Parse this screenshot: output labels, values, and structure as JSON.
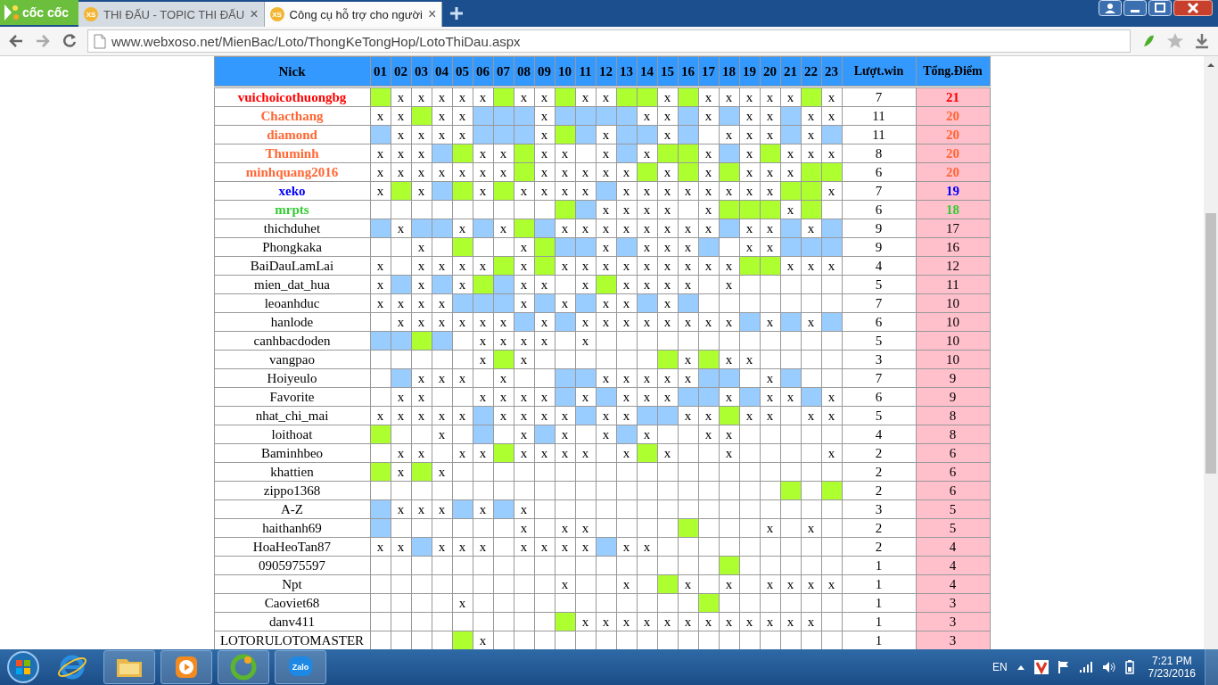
{
  "browser": {
    "logo_text": "cốc cốc",
    "tabs": [
      {
        "icon_text": "XS",
        "title": "THI ĐẤU - TOPIC THI ĐẤU",
        "close": "×",
        "selected": false
      },
      {
        "icon_text": "XS",
        "title": "Công cụ hỗ trợ cho người",
        "close": "×",
        "selected": true
      }
    ],
    "address": "www.webxoso.net/MienBac/Loto/ThongKeTongHop/LotoThiDau.aspx"
  },
  "table": {
    "columns": [
      "Nick",
      "01",
      "02",
      "03",
      "04",
      "05",
      "06",
      "07",
      "08",
      "09",
      "10",
      "11",
      "12",
      "13",
      "14",
      "15",
      "16",
      "17",
      "18",
      "19",
      "20",
      "21",
      "22",
      "23",
      "Lượt.win",
      "Tổng.Điểm"
    ],
    "rows": [
      {
        "color": "#ff0000",
        "cells": [
          "vuichoicothuongbg",
          {
            "kind": "green"
          },
          "x",
          "x",
          "x",
          "x",
          "x",
          {
            "kind": "green"
          },
          "x",
          "x",
          {
            "kind": "green"
          },
          "x",
          "x",
          {
            "kind": "green"
          },
          {
            "kind": "green"
          },
          "x",
          {
            "kind": "green"
          },
          "x",
          "x",
          "x",
          "x",
          "x",
          {
            "kind": "green"
          },
          "x",
          "7",
          "21"
        ]
      },
      {
        "color": "#ff6633",
        "cells": [
          "Chacthang",
          "x",
          "x",
          {
            "kind": "green"
          },
          "x",
          "x",
          {
            "kind": "blue"
          },
          {
            "kind": "blue"
          },
          {
            "kind": "blue"
          },
          "x",
          {
            "kind": "blue"
          },
          {
            "kind": "blue"
          },
          {
            "kind": "blue"
          },
          {
            "kind": "blue"
          },
          "x",
          "x",
          {
            "kind": "blue"
          },
          "x",
          {
            "kind": "blue"
          },
          "x",
          "x",
          {
            "kind": "blue"
          },
          "x",
          "x",
          "11",
          "20"
        ]
      },
      {
        "color": "#ff6633",
        "cells": [
          "diamond",
          {
            "kind": "blue"
          },
          "x",
          "x",
          "x",
          "x",
          {
            "kind": "blue"
          },
          {
            "kind": "blue"
          },
          {
            "kind": "blue"
          },
          "x",
          {
            "kind": "green"
          },
          {
            "kind": "blue"
          },
          "x",
          {
            "kind": "blue"
          },
          {
            "kind": "blue"
          },
          "x",
          {
            "kind": "blue"
          },
          "",
          "x",
          "x",
          "x",
          {
            "kind": "blue"
          },
          "x",
          {
            "kind": "blue"
          },
          "11",
          "20"
        ]
      },
      {
        "color": "#ff6633",
        "cells": [
          "Thuminh",
          "x",
          "x",
          "x",
          {
            "kind": "blue"
          },
          {
            "kind": "green"
          },
          "x",
          "x",
          {
            "kind": "green"
          },
          "x",
          "x",
          "",
          "x",
          {
            "kind": "blue"
          },
          "x",
          {
            "kind": "green"
          },
          {
            "kind": "green"
          },
          "x",
          {
            "kind": "blue"
          },
          "x",
          {
            "kind": "green"
          },
          "x",
          "x",
          "x",
          "8",
          "20"
        ]
      },
      {
        "color": "#ff6633",
        "cells": [
          "minhquang2016",
          "x",
          "x",
          "x",
          "x",
          "x",
          "x",
          "x",
          {
            "kind": "green"
          },
          "x",
          "x",
          "x",
          "x",
          "x",
          {
            "kind": "green"
          },
          "x",
          {
            "kind": "green"
          },
          "x",
          {
            "kind": "green"
          },
          "x",
          "x",
          "x",
          {
            "kind": "green"
          },
          {
            "kind": "green"
          },
          "6",
          "20"
        ]
      },
      {
        "color": "#0000ff",
        "cells": [
          "xeko",
          "x",
          {
            "kind": "green"
          },
          "x",
          {
            "kind": "blue"
          },
          {
            "kind": "green"
          },
          "x",
          {
            "kind": "green"
          },
          "x",
          "x",
          "x",
          "x",
          {
            "kind": "blue"
          },
          "x",
          "x",
          "x",
          "x",
          "x",
          "x",
          "x",
          "x",
          {
            "kind": "green"
          },
          {
            "kind": "green"
          },
          "x",
          "7",
          "19"
        ]
      },
      {
        "color": "#33cc33",
        "cells": [
          "mrpts",
          "",
          "",
          "",
          "",
          "",
          "",
          "",
          "",
          "",
          {
            "kind": "green"
          },
          {
            "kind": "blue"
          },
          "x",
          "x",
          "x",
          "x",
          "",
          "x",
          {
            "kind": "green"
          },
          {
            "kind": "green"
          },
          {
            "kind": "green"
          },
          "x",
          {
            "kind": "green"
          },
          "",
          "6",
          "18"
        ]
      },
      {
        "cells": [
          "thichduhet",
          {
            "kind": "blue"
          },
          "x",
          {
            "kind": "blue"
          },
          {
            "kind": "blue"
          },
          "x",
          {
            "kind": "blue"
          },
          "x",
          {
            "kind": "green"
          },
          {
            "kind": "blue"
          },
          "x",
          "x",
          "x",
          "x",
          "x",
          "x",
          "x",
          "x",
          {
            "kind": "blue"
          },
          "x",
          "x",
          {
            "kind": "blue"
          },
          "x",
          {
            "kind": "blue"
          },
          "9",
          "17"
        ]
      },
      {
        "cells": [
          "Phongkaka",
          "",
          "",
          "x",
          "",
          {
            "kind": "green"
          },
          "",
          "",
          "x",
          {
            "kind": "green"
          },
          {
            "kind": "blue"
          },
          {
            "kind": "blue"
          },
          "x",
          {
            "kind": "blue"
          },
          "x",
          "x",
          "x",
          {
            "kind": "blue"
          },
          "",
          "x",
          "x",
          {
            "kind": "blue"
          },
          {
            "kind": "blue"
          },
          {
            "kind": "blue"
          },
          "9",
          "16"
        ]
      },
      {
        "cells": [
          "BaiDauLamLai",
          "x",
          "",
          "x",
          "x",
          "x",
          "x",
          {
            "kind": "green"
          },
          "x",
          {
            "kind": "green"
          },
          "x",
          "x",
          "x",
          "x",
          "x",
          "x",
          "x",
          "x",
          "x",
          {
            "kind": "green"
          },
          {
            "kind": "green"
          },
          "x",
          "x",
          "x",
          "4",
          "12"
        ]
      },
      {
        "cells": [
          "mien_dat_hua",
          "x",
          {
            "kind": "blue"
          },
          "x",
          {
            "kind": "blue"
          },
          "x",
          {
            "kind": "green"
          },
          {
            "kind": "blue"
          },
          "x",
          "x",
          "",
          "x",
          {
            "kind": "green"
          },
          "x",
          "x",
          "x",
          "x",
          "",
          "x",
          "",
          "",
          "",
          "",
          "",
          "5",
          "11"
        ]
      },
      {
        "cells": [
          "leoanhduc",
          "x",
          "x",
          "x",
          "x",
          {
            "kind": "blue"
          },
          {
            "kind": "blue"
          },
          {
            "kind": "blue"
          },
          "x",
          {
            "kind": "blue"
          },
          "x",
          {
            "kind": "blue"
          },
          "x",
          "x",
          {
            "kind": "blue"
          },
          "x",
          {
            "kind": "blue"
          },
          "",
          "",
          "",
          "",
          "",
          "",
          "",
          "7",
          "10"
        ]
      },
      {
        "cells": [
          "hanlode",
          "",
          "x",
          "x",
          "x",
          "x",
          "x",
          "x",
          {
            "kind": "blue"
          },
          "x",
          {
            "kind": "blue"
          },
          "x",
          "x",
          "x",
          "x",
          "x",
          "x",
          "x",
          "x",
          {
            "kind": "blue"
          },
          "x",
          {
            "kind": "blue"
          },
          "x",
          {
            "kind": "blue"
          },
          "6",
          "10"
        ]
      },
      {
        "cells": [
          "canhbacdoden",
          {
            "kind": "blue"
          },
          {
            "kind": "blue"
          },
          {
            "kind": "green"
          },
          {
            "kind": "blue"
          },
          "",
          "x",
          "x",
          "x",
          "x",
          "",
          "x",
          "",
          "",
          "",
          "",
          "",
          "",
          "",
          "",
          "",
          "",
          "",
          "",
          "5",
          "10"
        ]
      },
      {
        "cells": [
          "vangpao",
          "",
          "",
          "",
          "",
          "",
          "x",
          {
            "kind": "green"
          },
          "x",
          "",
          "",
          "",
          "",
          "",
          "",
          {
            "kind": "green"
          },
          "x",
          {
            "kind": "green"
          },
          "x",
          "x",
          "",
          "",
          "",
          "",
          "3",
          "10"
        ]
      },
      {
        "cells": [
          "Hoiyeulo",
          "",
          {
            "kind": "blue"
          },
          "x",
          "x",
          "x",
          "",
          "x",
          "",
          "",
          {
            "kind": "blue"
          },
          {
            "kind": "blue"
          },
          "x",
          "x",
          "x",
          "x",
          "x",
          {
            "kind": "blue"
          },
          {
            "kind": "blue"
          },
          "",
          "x",
          {
            "kind": "blue"
          },
          "",
          "",
          "7",
          "9"
        ]
      },
      {
        "cells": [
          "Favorite",
          "",
          "x",
          "x",
          "",
          "",
          "x",
          "x",
          "x",
          "x",
          {
            "kind": "blue"
          },
          "x",
          {
            "kind": "blue"
          },
          "x",
          "x",
          "x",
          {
            "kind": "blue"
          },
          {
            "kind": "blue"
          },
          "x",
          {
            "kind": "blue"
          },
          "x",
          "x",
          {
            "kind": "blue"
          },
          "x",
          "6",
          "9"
        ]
      },
      {
        "cells": [
          "nhat_chi_mai",
          "x",
          "x",
          "x",
          "x",
          "x",
          {
            "kind": "blue"
          },
          "x",
          "x",
          "x",
          "x",
          {
            "kind": "blue"
          },
          "x",
          "x",
          {
            "kind": "blue"
          },
          {
            "kind": "blue"
          },
          "x",
          "x",
          {
            "kind": "green"
          },
          "x",
          "x",
          "",
          "x",
          "x",
          "5",
          "8"
        ]
      },
      {
        "cells": [
          "loithoat",
          {
            "kind": "green"
          },
          "",
          "",
          "x",
          "",
          {
            "kind": "blue"
          },
          "",
          "x",
          {
            "kind": "blue"
          },
          "x",
          "",
          "x",
          {
            "kind": "blue"
          },
          "x",
          "",
          "",
          "x",
          "x",
          "",
          "",
          "",
          "",
          "",
          "4",
          "8"
        ]
      },
      {
        "cells": [
          "Baminhbeo",
          "",
          "x",
          "x",
          "",
          "x",
          "x",
          {
            "kind": "green"
          },
          "x",
          "x",
          "x",
          "x",
          "",
          "x",
          {
            "kind": "green"
          },
          "x",
          "",
          "",
          "x",
          "",
          "",
          "",
          "",
          "x",
          "2",
          "6"
        ]
      },
      {
        "cells": [
          "khattien",
          {
            "kind": "green"
          },
          "x",
          {
            "kind": "green"
          },
          "x",
          "",
          "",
          "",
          "",
          "",
          "",
          "",
          "",
          "",
          "",
          "",
          "",
          "",
          "",
          "",
          "",
          "",
          "",
          "",
          "2",
          "6"
        ]
      },
      {
        "cells": [
          "zippo1368",
          "",
          "",
          "",
          "",
          "",
          "",
          "",
          "",
          "",
          "",
          "",
          "",
          "",
          "",
          "",
          "",
          "",
          "",
          "",
          "",
          {
            "kind": "green"
          },
          "",
          {
            "kind": "green"
          },
          "2",
          "6"
        ]
      },
      {
        "cells": [
          "A-Z",
          {
            "kind": "blue"
          },
          "x",
          "x",
          "x",
          {
            "kind": "blue"
          },
          "x",
          {
            "kind": "blue"
          },
          "x",
          "",
          "",
          "",
          "",
          "",
          "",
          "",
          "",
          "",
          "",
          "",
          "",
          "",
          "",
          "",
          "3",
          "5"
        ]
      },
      {
        "cells": [
          "haithanh69",
          {
            "kind": "blue"
          },
          "",
          "",
          "",
          "",
          "",
          "",
          "x",
          "",
          "x",
          "x",
          "",
          "",
          "",
          "",
          {
            "kind": "green"
          },
          "",
          "",
          "",
          "x",
          "",
          "x",
          "",
          "2",
          "5"
        ]
      },
      {
        "cells": [
          "HoaHeoTan87",
          "x",
          "x",
          {
            "kind": "blue"
          },
          "x",
          "x",
          "x",
          "",
          "x",
          "x",
          "x",
          "x",
          {
            "kind": "blue"
          },
          "x",
          "x",
          "",
          "",
          "",
          "",
          "",
          "",
          "",
          "",
          "",
          "2",
          "4"
        ]
      },
      {
        "cells": [
          "0905975597",
          "",
          "",
          "",
          "",
          "",
          "",
          "",
          "",
          "",
          "",
          "",
          "",
          "",
          "",
          "",
          "",
          "",
          {
            "kind": "green"
          },
          "",
          "",
          "",
          "",
          "",
          "1",
          "4"
        ]
      },
      {
        "cells": [
          "Npt",
          "",
          "",
          "",
          "",
          "",
          "",
          "",
          "",
          "",
          "x",
          "",
          "",
          "x",
          "",
          {
            "kind": "green"
          },
          "x",
          "",
          "x",
          "",
          "x",
          "x",
          "x",
          "x",
          "1",
          "4"
        ]
      },
      {
        "cells": [
          "Caoviet68",
          "",
          "",
          "",
          "",
          "x",
          "",
          "",
          "",
          "",
          "",
          "",
          "",
          "",
          "",
          "",
          "",
          {
            "kind": "green"
          },
          "",
          "",
          "",
          "",
          "",
          "",
          "1",
          "3"
        ]
      },
      {
        "cells": [
          "danv411",
          "",
          "",
          "",
          "",
          "",
          "",
          "",
          "",
          "",
          {
            "kind": "green"
          },
          "x",
          "x",
          "x",
          "x",
          "x",
          "x",
          "x",
          "x",
          "x",
          "x",
          "x",
          "x",
          "",
          "1",
          "3"
        ]
      },
      {
        "cells": [
          "LOTORULOTOMASTER",
          "",
          "",
          "",
          "",
          {
            "kind": "green"
          },
          "x",
          "",
          "",
          "",
          "",
          "",
          "",
          "",
          "",
          "",
          "",
          "",
          "",
          "",
          "",
          "",
          "",
          "",
          "1",
          "3"
        ]
      }
    ]
  },
  "taskbar": {
    "apps": [
      {
        "kind": "ie"
      },
      {
        "kind": "folder"
      },
      {
        "kind": "media"
      },
      {
        "kind": "coccoc"
      },
      {
        "kind": "zalo",
        "label": "Zalo"
      }
    ],
    "language": "EN",
    "time": "7:21 PM",
    "date": "7/23/2016"
  }
}
